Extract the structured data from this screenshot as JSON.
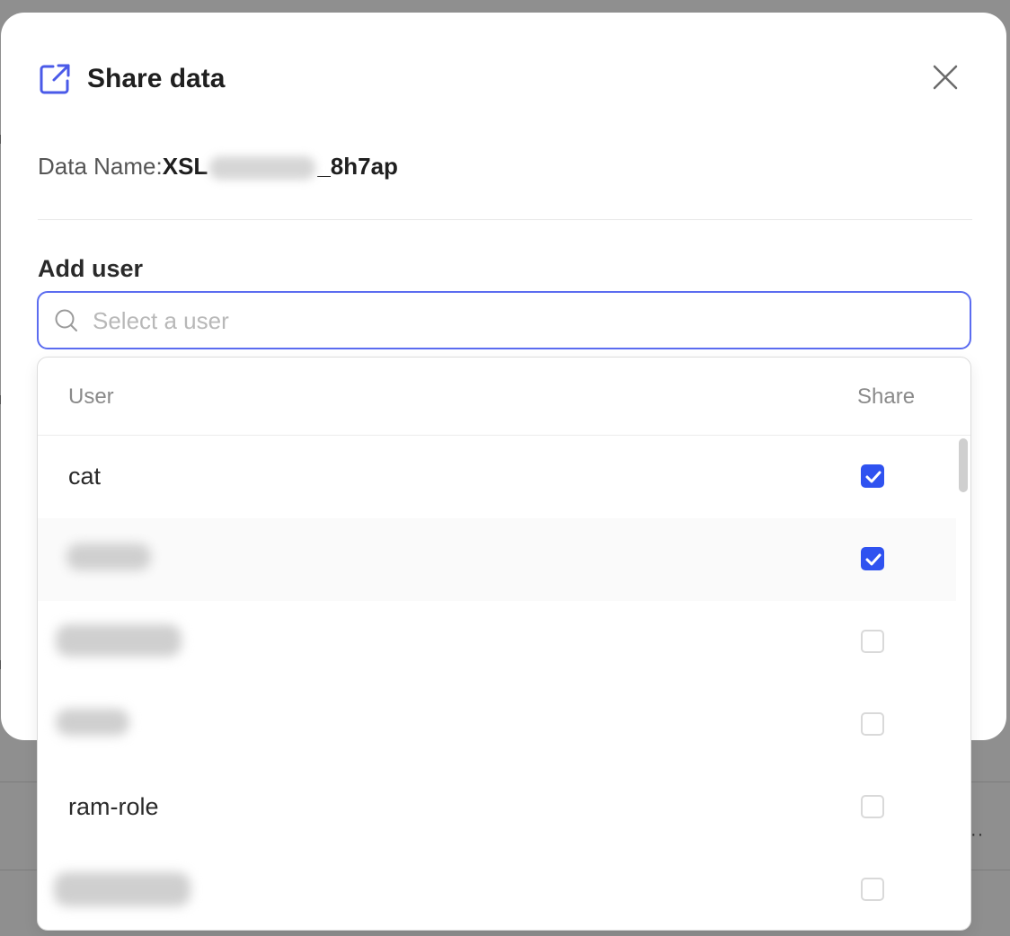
{
  "modal": {
    "title": "Share data",
    "data_name_label": "Data Name:",
    "data_name_prefix": "XSL",
    "data_name_suffix": "_8h7ap",
    "section_label": "Add user",
    "search": {
      "placeholder": "Select a user",
      "value": ""
    }
  },
  "dropdown": {
    "col_user": "User",
    "col_share": "Share",
    "rows": [
      {
        "label": "cat",
        "checked": true
      },
      {
        "label": "",
        "checked": true
      },
      {
        "label": "",
        "checked": false
      },
      {
        "label": "",
        "checked": false
      },
      {
        "label": "ram-role",
        "checked": false
      },
      {
        "label": "",
        "checked": false
      }
    ]
  },
  "icons": {
    "header": "share-external-icon",
    "close": "close-icon",
    "search": "search-icon",
    "check": "check-icon"
  },
  "colors": {
    "accent": "#2f52f0",
    "focus_border": "#5b6cf0",
    "overlay": "#8f8f8f"
  }
}
